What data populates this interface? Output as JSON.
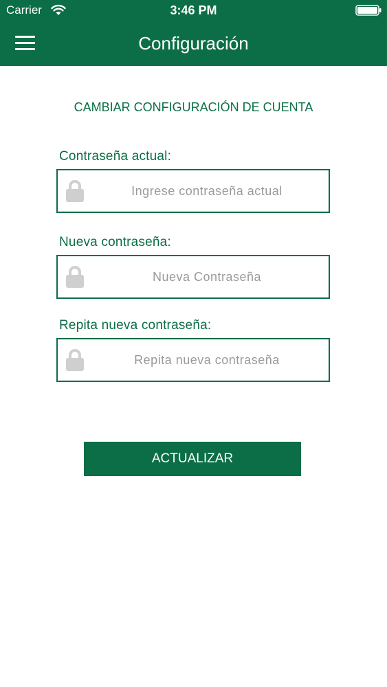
{
  "status_bar": {
    "carrier": "Carrier",
    "time": "3:46 PM",
    "wifi_icon": "wifi-icon",
    "battery_icon": "battery-icon"
  },
  "nav_bar": {
    "title": "Configuración",
    "menu_icon": "hamburger-menu-icon",
    "background_color": "#0b6e46"
  },
  "form": {
    "section_title": "CAMBIAR CONFIGURACIÓN DE CUENTA",
    "fields": [
      {
        "label": "Contraseña actual:",
        "placeholder": "Ingrese contraseña actual",
        "value": "",
        "icon": "lock-icon"
      },
      {
        "label": "Nueva contraseña:",
        "placeholder": "Nueva Contraseña",
        "value": "",
        "icon": "lock-icon"
      },
      {
        "label": "Repita nueva contraseña:",
        "placeholder": "Repita nueva contraseña",
        "value": "",
        "icon": "lock-icon"
      }
    ],
    "submit_label": "ACTUALIZAR"
  },
  "colors": {
    "accent": "#0b6e46",
    "placeholder": "#9a9a9a",
    "lock_icon": "#cfcfcf"
  }
}
